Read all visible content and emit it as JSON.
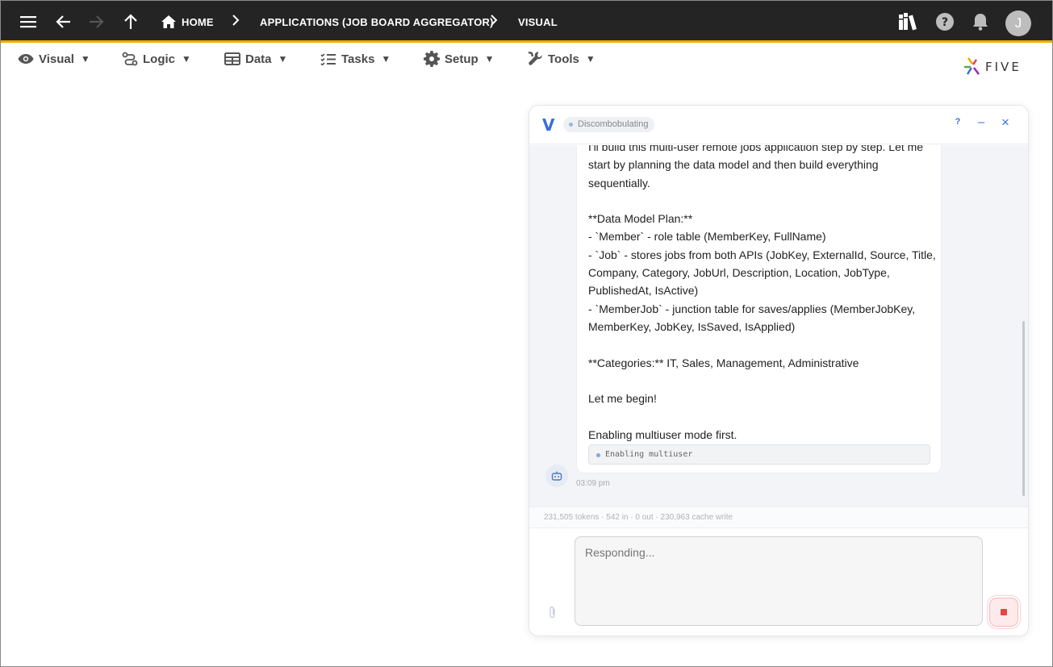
{
  "topbar": {
    "home_label": "HOME",
    "crumbs": [
      "APPLICATIONS (JOB BOARD AGGREGATOR)",
      "VISUAL"
    ],
    "avatar_initial": "J",
    "icons": [
      "menu-icon",
      "back-arrow-icon",
      "forward-arrow-icon",
      "up-arrow-icon",
      "home-icon",
      "library-icon",
      "help-icon",
      "bell-icon"
    ],
    "accent_color": "#f2a900"
  },
  "menu": {
    "items": [
      {
        "label": "Visual",
        "icon": "eye-icon"
      },
      {
        "label": "Logic",
        "icon": "logic-icon"
      },
      {
        "label": "Data",
        "icon": "table-icon"
      },
      {
        "label": "Tasks",
        "icon": "checklist-icon"
      },
      {
        "label": "Setup",
        "icon": "gear-icon"
      },
      {
        "label": "Tools",
        "icon": "tools-icon"
      }
    ],
    "caret": "▼",
    "logo_text": "FIVE"
  },
  "chat": {
    "v_logo": "V",
    "status": "Discombobulating",
    "header_buttons": {
      "help": "?",
      "minimize": "–",
      "close": "×"
    },
    "message": {
      "lines": [
        "I'll build this multi-user remote jobs application step by step. Let me",
        "start by planning the data model and then build everything",
        "sequentially.",
        "",
        "**Data Model Plan:**",
        "- `Member` - role table (MemberKey, FullName)",
        "- `Job` - stores jobs from both APIs (JobKey, ExternalId, Source, Title,",
        "Company, Category, JobUrl, Description, Location, JobType,",
        "PublishedAt, IsActive)",
        "- `MemberJob` - junction table for saves/applies (MemberJobKey,",
        "MemberKey, JobKey, IsSaved, IsApplied)",
        "",
        "**Categories:** IT, Sales, Management, Administrative",
        "",
        "Let me begin!",
        "",
        "Enabling multiuser mode first."
      ],
      "tool_chip": "Enabling multiuser",
      "timestamp": "03:09 pm"
    },
    "tokens": "231,505 tokens · 542 in · 0 out · 230,963 cache write",
    "input_placeholder": "Responding...",
    "stop_color": "#e04848"
  }
}
